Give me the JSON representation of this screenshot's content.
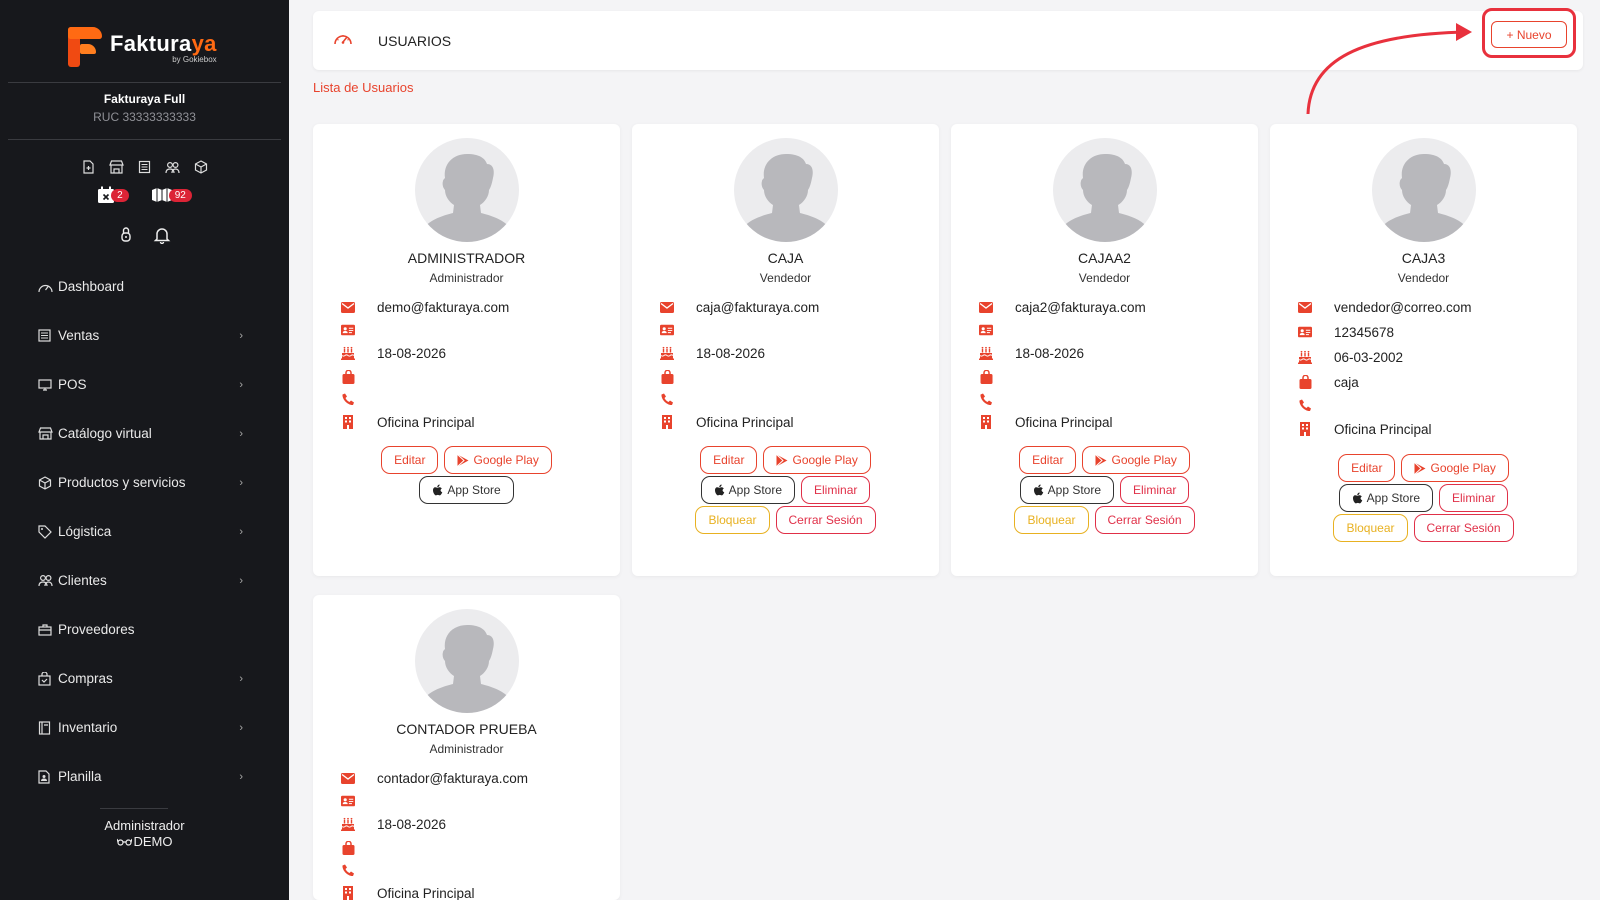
{
  "brand": {
    "name_main": "Faktura",
    "name_accent": "ya",
    "by": "by Gokiebox"
  },
  "company": {
    "name": "Fakturaya Full",
    "ruc": "RUC 33333333333"
  },
  "badges": {
    "calendar": "2",
    "boxes": "92"
  },
  "nav": [
    {
      "label": "Dashboard",
      "icon": "dashboard-icon",
      "chevron": false
    },
    {
      "label": "Ventas",
      "icon": "ventas-icon",
      "chevron": true
    },
    {
      "label": "POS",
      "icon": "monitor-icon",
      "chevron": true
    },
    {
      "label": "Catálogo virtual",
      "icon": "store-icon",
      "chevron": true
    },
    {
      "label": "Productos y servicios",
      "icon": "box-icon",
      "chevron": true
    },
    {
      "label": "Lógistica",
      "icon": "tag-icon",
      "chevron": true
    },
    {
      "label": "Clientes",
      "icon": "users-icon",
      "chevron": true
    },
    {
      "label": "Proveedores",
      "icon": "briefcase-icon",
      "chevron": false
    },
    {
      "label": "Compras",
      "icon": "bag-icon",
      "chevron": true
    },
    {
      "label": "Inventario",
      "icon": "book-icon",
      "chevron": true
    },
    {
      "label": "Planilla",
      "icon": "file-icon",
      "chevron": true
    }
  ],
  "footer_user": {
    "role": "Administrador",
    "name": "DEMO"
  },
  "header": {
    "title": "USUARIOS",
    "new_button": "+ Nuevo"
  },
  "list_title": "Lista de Usuarios",
  "buttons": {
    "edit": "Editar",
    "google_play": "Google Play",
    "app_store": "App Store",
    "delete": "Eliminar",
    "block": "Bloquear",
    "logout": "Cerrar Sesión"
  },
  "colors": {
    "accent": "#e8432d",
    "sidebar": "#17181c",
    "badge": "#dc2436",
    "warning": "#e8b121"
  },
  "users": [
    {
      "name": "ADMINISTRADOR",
      "role": "Administrador",
      "email": "demo@fakturaya.com",
      "document": "",
      "birthday": "18-08-2026",
      "position": "",
      "phone": "",
      "branch": "Oficina Principal"
    },
    {
      "name": "CAJA",
      "role": "Vendedor",
      "email": "caja@fakturaya.com",
      "document": "",
      "birthday": "18-08-2026",
      "position": "",
      "phone": "",
      "branch": "Oficina Principal"
    },
    {
      "name": "CAJAA2",
      "role": "Vendedor",
      "email": "caja2@fakturaya.com",
      "document": "",
      "birthday": "18-08-2026",
      "position": "",
      "phone": "",
      "branch": "Oficina Principal"
    },
    {
      "name": "CAJA3",
      "role": "Vendedor",
      "email": "vendedor@correo.com",
      "document": "12345678",
      "birthday": "06-03-2002",
      "position": "caja",
      "phone": "",
      "branch": "Oficina Principal"
    },
    {
      "name": "CONTADOR PRUEBA",
      "role": "Administrador",
      "email": "contador@fakturaya.com",
      "document": "",
      "birthday": "18-08-2026",
      "position": "",
      "phone": "",
      "branch": "Oficina Principal"
    }
  ]
}
